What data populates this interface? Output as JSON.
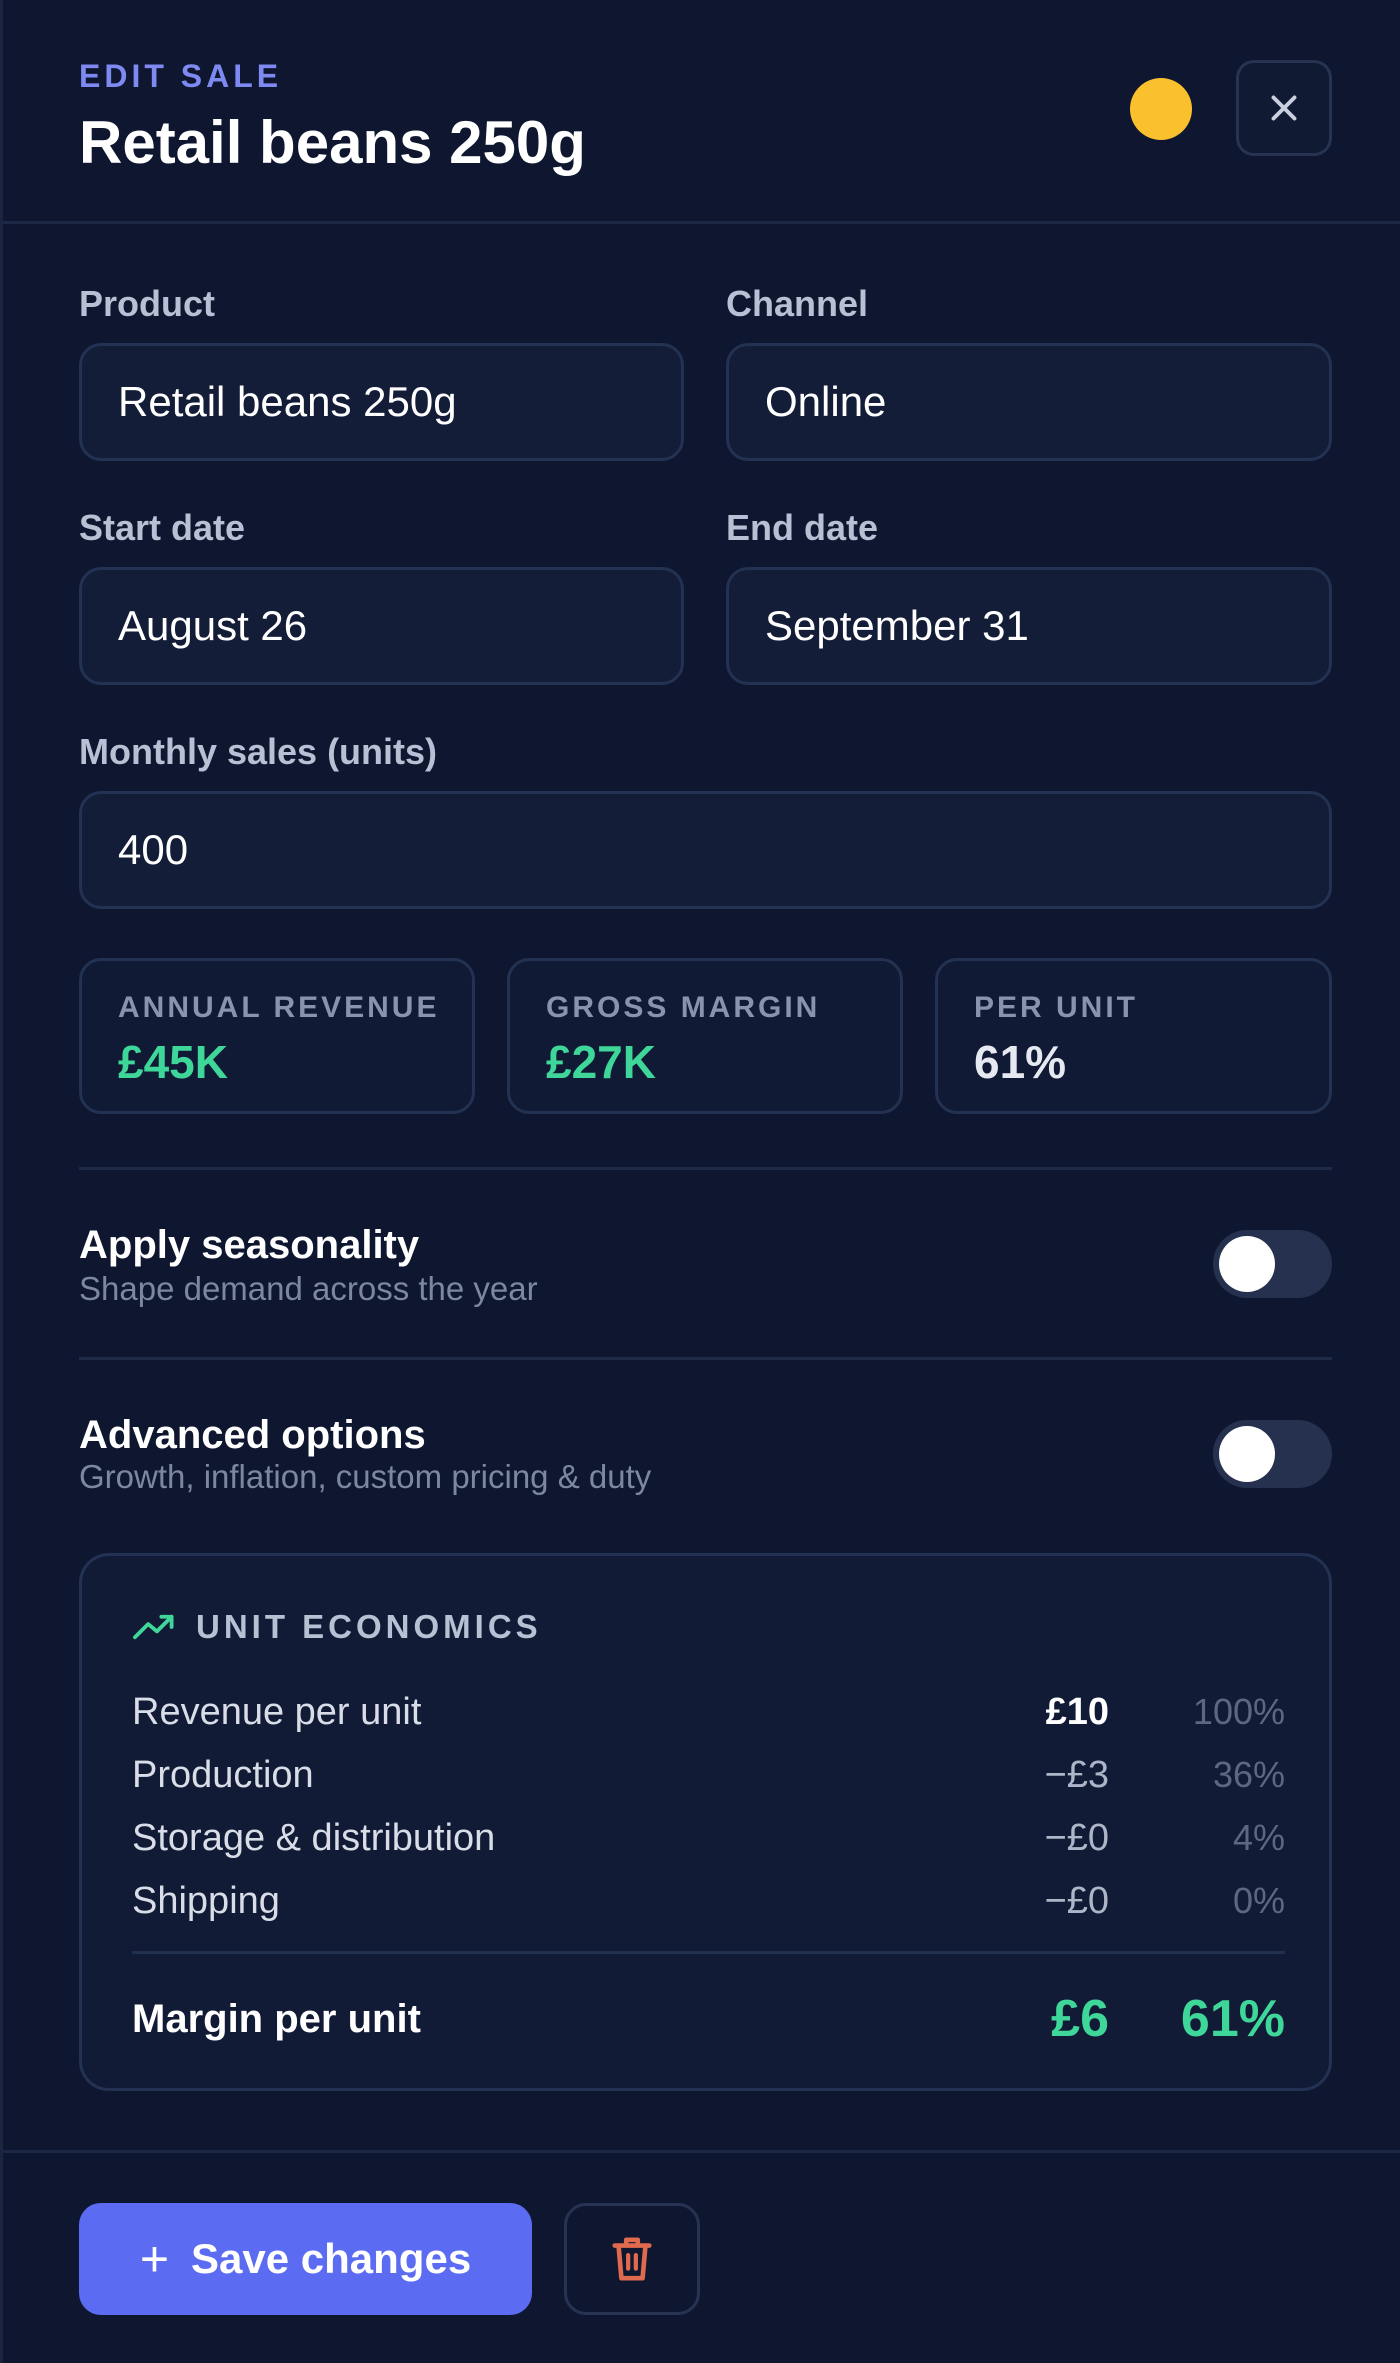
{
  "header": {
    "eyebrow": "EDIT SALE",
    "title": "Retail beans 250g",
    "status_color": "#fbc02d",
    "close_icon": "close-icon"
  },
  "form": {
    "product": {
      "label": "Product",
      "value": "Retail beans 250g"
    },
    "channel": {
      "label": "Channel",
      "value": "Online"
    },
    "start_date": {
      "label": "Start date",
      "value": "August 26"
    },
    "end_date": {
      "label": "End date",
      "value": "September 31"
    },
    "monthly_sales": {
      "label": "Monthly sales (units)",
      "value": "400"
    }
  },
  "stats": [
    {
      "label": "ANNUAL REVENUE",
      "value": "£45K",
      "color": "#3fd69a"
    },
    {
      "label": "GROSS MARGIN",
      "value": "£27K",
      "color": "#3fd69a"
    },
    {
      "label": "PER UNIT",
      "value": "61%",
      "color": "#e6e9f2"
    }
  ],
  "toggles": {
    "seasonality": {
      "title": "Apply seasonality",
      "subtitle": "Shape demand across the year",
      "on": false
    },
    "advanced": {
      "title": "Advanced options",
      "subtitle": "Growth, inflation, custom pricing & duty",
      "on": false
    }
  },
  "unit_economics": {
    "title": "UNIT ECONOMICS",
    "icon": "trending-up-icon",
    "rows": [
      {
        "name": "Revenue per unit",
        "amount": "£10",
        "percent": "100%"
      },
      {
        "name": "Production",
        "amount": "−£3",
        "percent": "36%"
      },
      {
        "name": "Storage & distribution",
        "amount": "−£0",
        "percent": "4%"
      },
      {
        "name": "Shipping",
        "amount": "−£0",
        "percent": "0%"
      }
    ],
    "total": {
      "name": "Margin per unit",
      "amount": "£6",
      "percent": "61%"
    }
  },
  "footer": {
    "save_label": "Save changes",
    "delete_icon": "trash-icon",
    "accent": "#5b6cf2",
    "danger": "#e06a4e"
  }
}
